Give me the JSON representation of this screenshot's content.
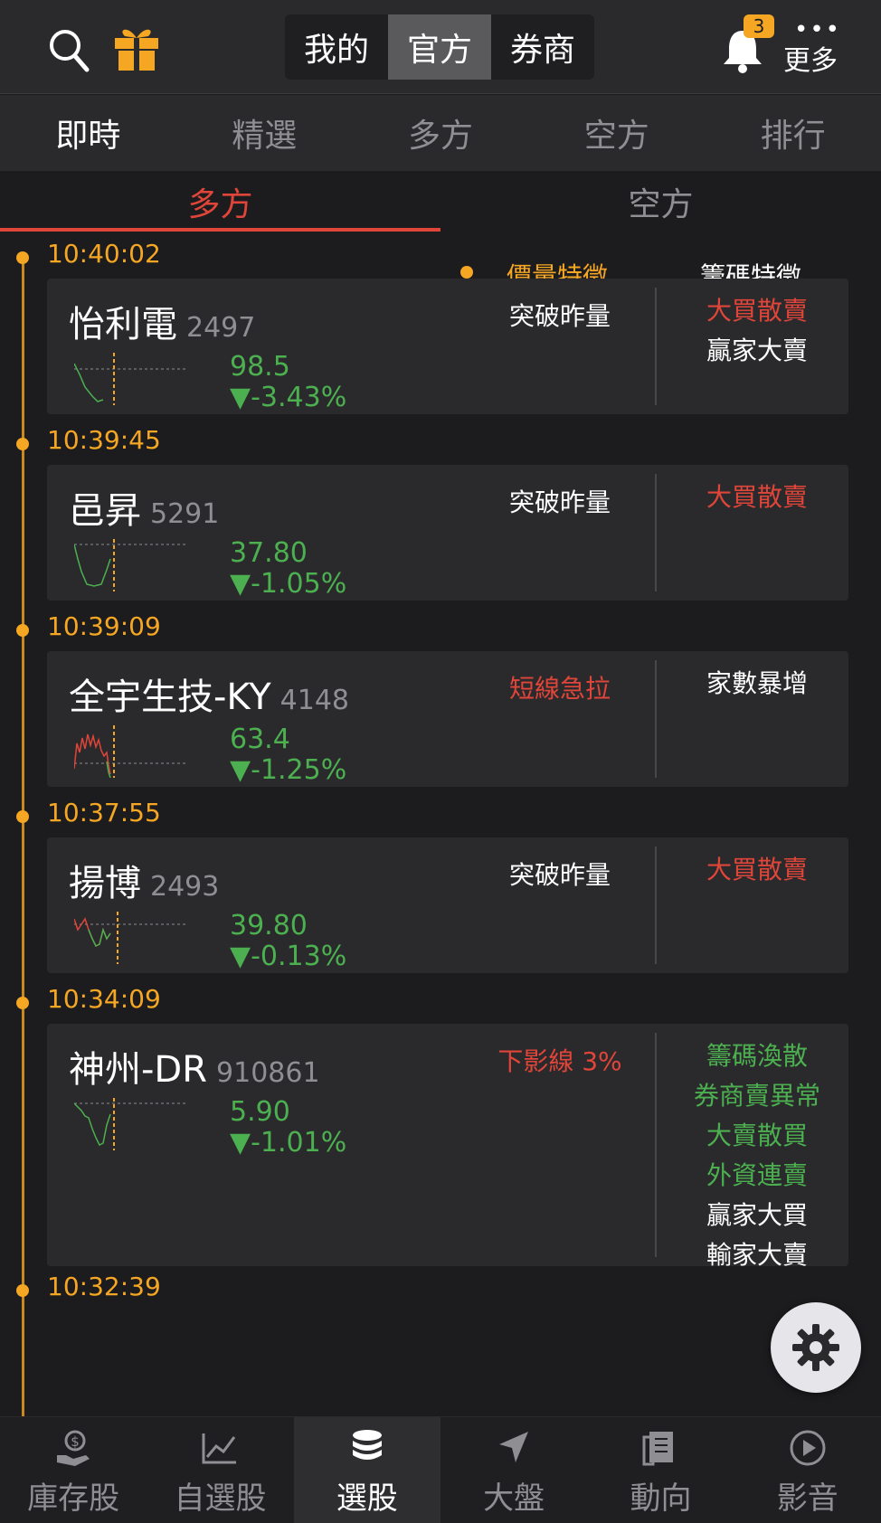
{
  "header": {
    "segments": [
      "我的",
      "官方",
      "券商"
    ],
    "active_segment": "官方",
    "notification_count": "3",
    "more_label": "更多"
  },
  "category_tabs": [
    "即時",
    "精選",
    "多方",
    "空方",
    "排行"
  ],
  "sub_tabs": [
    "多方",
    "空方"
  ],
  "list_header": {
    "price_volume": "價量特徵",
    "chips": "籌碼特徵"
  },
  "events": [
    {
      "time": "10:40:02",
      "name": "怡利電",
      "code": "2497",
      "price": "98.5",
      "change": "▼-3.43%",
      "feature": "突破昨量",
      "feature_color": "white",
      "chips": [
        {
          "text": "大買散賣",
          "color": "red"
        },
        {
          "text": "贏家大賣",
          "color": "white"
        }
      ]
    },
    {
      "time": "10:39:45",
      "name": "邑昇",
      "code": "5291",
      "price": "37.80",
      "change": "▼-1.05%",
      "feature": "突破昨量",
      "feature_color": "white",
      "chips": [
        {
          "text": "大買散賣",
          "color": "red"
        }
      ]
    },
    {
      "time": "10:39:09",
      "name": "全宇生技-KY",
      "code": "4148",
      "price": "63.4",
      "change": "▼-1.25%",
      "feature": "短線急拉",
      "feature_color": "red",
      "chips": [
        {
          "text": "家數暴增",
          "color": "white"
        }
      ]
    },
    {
      "time": "10:37:55",
      "name": "揚博",
      "code": "2493",
      "price": "39.80",
      "change": "▼-0.13%",
      "feature": "突破昨量",
      "feature_color": "white",
      "chips": [
        {
          "text": "大買散賣",
          "color": "red"
        }
      ]
    },
    {
      "time": "10:34:09",
      "name": "神州-DR",
      "code": "910861",
      "price": "5.90",
      "change": "▼-1.01%",
      "feature": "下影線 3%",
      "feature_color": "red",
      "chips": [
        {
          "text": "籌碼渙散",
          "color": "green"
        },
        {
          "text": "券商賣異常",
          "color": "green"
        },
        {
          "text": "大賣散買",
          "color": "green"
        },
        {
          "text": "外資連賣",
          "color": "green"
        },
        {
          "text": "贏家大買",
          "color": "white"
        },
        {
          "text": "輸家大賣",
          "color": "white"
        }
      ]
    }
  ],
  "next_time": "10:32:39",
  "bottom_nav": [
    {
      "label": "庫存股",
      "icon": "money-hand-icon"
    },
    {
      "label": "自選股",
      "icon": "trend-chart-icon"
    },
    {
      "label": "選股",
      "icon": "database-stack-icon"
    },
    {
      "label": "大盤",
      "icon": "navigation-arrow-icon"
    },
    {
      "label": "動向",
      "icon": "document-icon"
    },
    {
      "label": "影音",
      "icon": "play-circle-icon"
    }
  ],
  "active_nav": "選股",
  "colors": {
    "accent": "#f5a623",
    "up": "#e0453a",
    "down": "#4cb050",
    "background": "#1c1c1e",
    "card": "#2a2a2c"
  }
}
